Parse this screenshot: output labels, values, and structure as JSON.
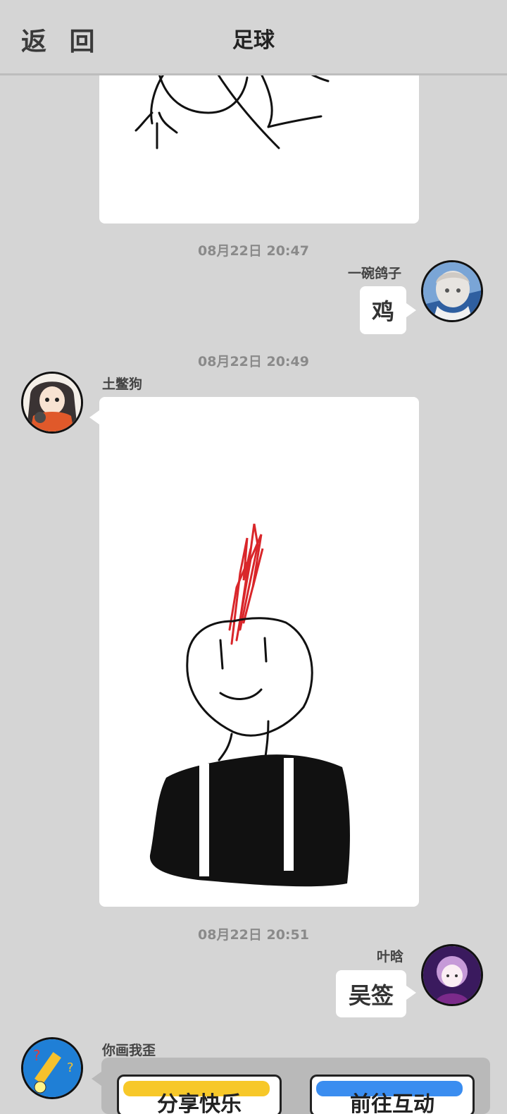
{
  "header": {
    "back_label": "返 回",
    "title": "足球"
  },
  "messages": [
    {
      "type": "drawing",
      "sender": "",
      "side": "left"
    },
    {
      "type": "text",
      "timestamp": "08月22日  20:47",
      "sender": "一碗鸽子",
      "text": "鸡",
      "side": "right"
    },
    {
      "type": "drawing",
      "timestamp": "08月22日  20:49",
      "sender": "土鳖狗",
      "side": "left"
    },
    {
      "type": "text",
      "timestamp": "08月22日  20:51",
      "sender": "叶晗",
      "text": "吴签",
      "side": "right"
    },
    {
      "type": "share",
      "sender": "你画我歪",
      "side": "left",
      "buttons": [
        {
          "label": "分享快乐",
          "accent": "#f7c829"
        },
        {
          "label": "前往互动",
          "accent": "#3a8df0"
        }
      ]
    }
  ],
  "colors": {
    "background": "#d5d5d5",
    "bubble": "#ffffff",
    "red_stroke": "#d9262a"
  },
  "icons": [
    "user-avatar-silver-hair",
    "user-avatar-red-dress-girl",
    "user-avatar-purple-girl",
    "game-pencil-avatar"
  ]
}
